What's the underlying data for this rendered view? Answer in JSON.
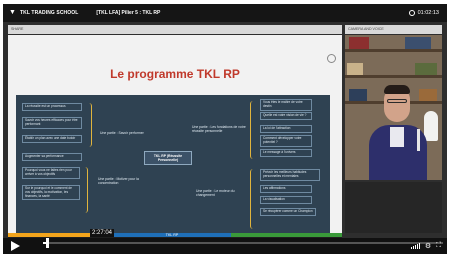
{
  "header": {
    "logo_text": "TKL TRADING SCHOOL",
    "title": "[TKL LFA] Pilier 5 : TKL RP",
    "timer": "01:02:13"
  },
  "panels": {
    "slides_label": "SHARE",
    "camera_label": "CAMERA AND VOICE"
  },
  "slide": {
    "title": "Le programme TKL RP",
    "center_node": "TKL RP (Réussite Personnelle)",
    "branches": [
      "Une partie : Les fondations de votre réussite personnelle",
      "Une partie : Savoir performer",
      "Une partie : Motiver pour la concentration",
      "Une partie : Le moteur du changement"
    ],
    "leaves_left": [
      "La réussite est un processus",
      "Savoir vos heures efficaces pour être performant",
      "Établir un plan avec une date butoir",
      "Augmenter sa performance",
      "Pourquoi vous ne faites rien pour arriver à vos objectifs",
      "Sur le pourquoi et le comment de vos objectifs, la motivation, les finances, la santé"
    ],
    "leaves_right": [
      "Vous êtes le maître de votre destin",
      "Quelle est votre vision de vie ?",
      "La loi de l'attraction",
      "Comment développer votre potentiel ?",
      "Le message à l'univers",
      "Prévoir les meilleurs habitudes personnelles et mentales",
      "Les affirmations",
      "La visualisation",
      "Se récupérer comme un Champion"
    ]
  },
  "progress": {
    "segment_label": "TKL RP"
  },
  "controls": {
    "time_tooltip": "2:27:04",
    "scrub_fraction": 0.01
  }
}
